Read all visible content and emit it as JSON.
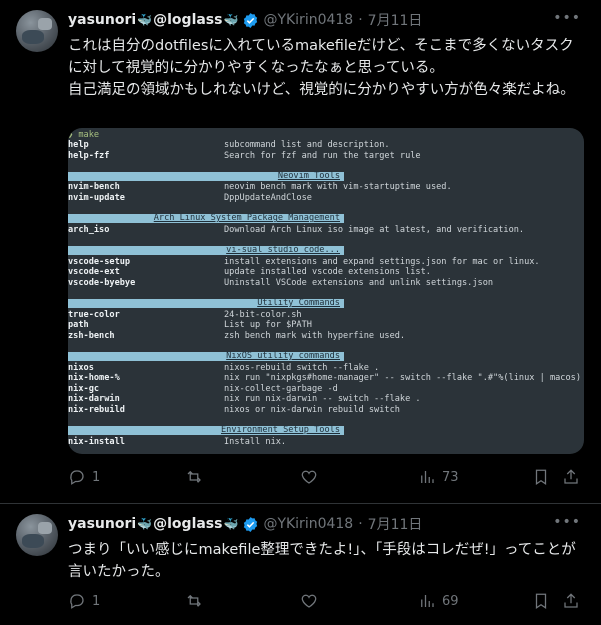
{
  "tweets": [
    {
      "author": {
        "name": "yasunori",
        "name_suffix": "@loglass",
        "handle": "@YKirin0418",
        "date": "7月11日"
      },
      "text_lines": [
        "これは自分のdotfilesに入れているmakefileだけど、そこまで多くないタスクに対して視覚的に分かりやすくなったなぁと思っている。",
        "自己満足の領域かもしれないけど、視覚的に分かりやすい方が色々楽だよね。"
      ],
      "code_image": {
        "prompt": "make",
        "rows": [
          {
            "cmd": "help",
            "desc": "subcommand list and description."
          },
          {
            "cmd": "help-fzf",
            "desc": "Search for fzf and run the target rule"
          },
          {
            "section": "Neovim Tools"
          },
          {
            "cmd": "nvim-bench",
            "desc": "neovim bench mark with vim-startuptime used."
          },
          {
            "cmd": "nvim-update",
            "desc": "DppUpdateAndClose"
          },
          {
            "section": "Arch Linux System Package Management"
          },
          {
            "cmd": "arch_iso",
            "desc": "Download Arch Linux iso image at latest, and verification."
          },
          {
            "section": "vi-sual studio code..."
          },
          {
            "cmd": "vscode-setup",
            "desc": "install extensions and expand settings.json for mac or linux."
          },
          {
            "cmd": "vscode-ext",
            "desc": "update installed vscode extensions list."
          },
          {
            "cmd": "vscode-byebye",
            "desc": "Uninstall VSCode extensions and unlink settings.json"
          },
          {
            "section": "Utility Commands"
          },
          {
            "cmd": "true-color",
            "desc": "24-bit-color.sh"
          },
          {
            "cmd": "path",
            "desc": "List up for $PATH"
          },
          {
            "cmd": "zsh-bench",
            "desc": "zsh bench mark with hyperfine used."
          },
          {
            "section": "NixOS utility commands"
          },
          {
            "cmd": "nixos",
            "desc": "nixos-rebuild switch --flake ."
          },
          {
            "cmd": "nix-home-%",
            "desc": "nix run \"nixpkgs#home-manager\" -- switch --flake \".#\"%(linux | macos)"
          },
          {
            "cmd": "nix-gc",
            "desc": "nix-collect-garbage -d"
          },
          {
            "cmd": "nix-darwin",
            "desc": "nix run nix-darwin -- switch --flake ."
          },
          {
            "cmd": "nix-rebuild",
            "desc": "nixos or nix-darwin rebuild switch"
          },
          {
            "section": "Environment Setup Tools"
          },
          {
            "cmd": "nix-install",
            "desc": "Install nix."
          }
        ]
      },
      "actions": {
        "reply": "1",
        "retweet": "",
        "like": "",
        "views": "73"
      }
    },
    {
      "author": {
        "name": "yasunori",
        "name_suffix": "@loglass",
        "handle": "@YKirin0418",
        "date": "7月11日"
      },
      "text_lines": [
        "つまり「いい感じにmakefile整理できたよ!」、「手段はコレだぜ!」ってことが言いたかった。"
      ],
      "actions": {
        "reply": "1",
        "retweet": "",
        "like": "",
        "views": "69"
      }
    }
  ],
  "icons": {
    "whale": "whale-icon",
    "verified": "verified-badge-icon",
    "more": "more-icon",
    "reply": "reply-icon",
    "retweet": "retweet-icon",
    "like": "like-icon",
    "views": "views-icon",
    "bookmark": "bookmark-icon",
    "share": "share-icon"
  },
  "colors": {
    "accent": "#1d9bf0",
    "muted": "#71767b",
    "code_bg": "#2b3339",
    "section_bg": "#8fc1d6"
  }
}
